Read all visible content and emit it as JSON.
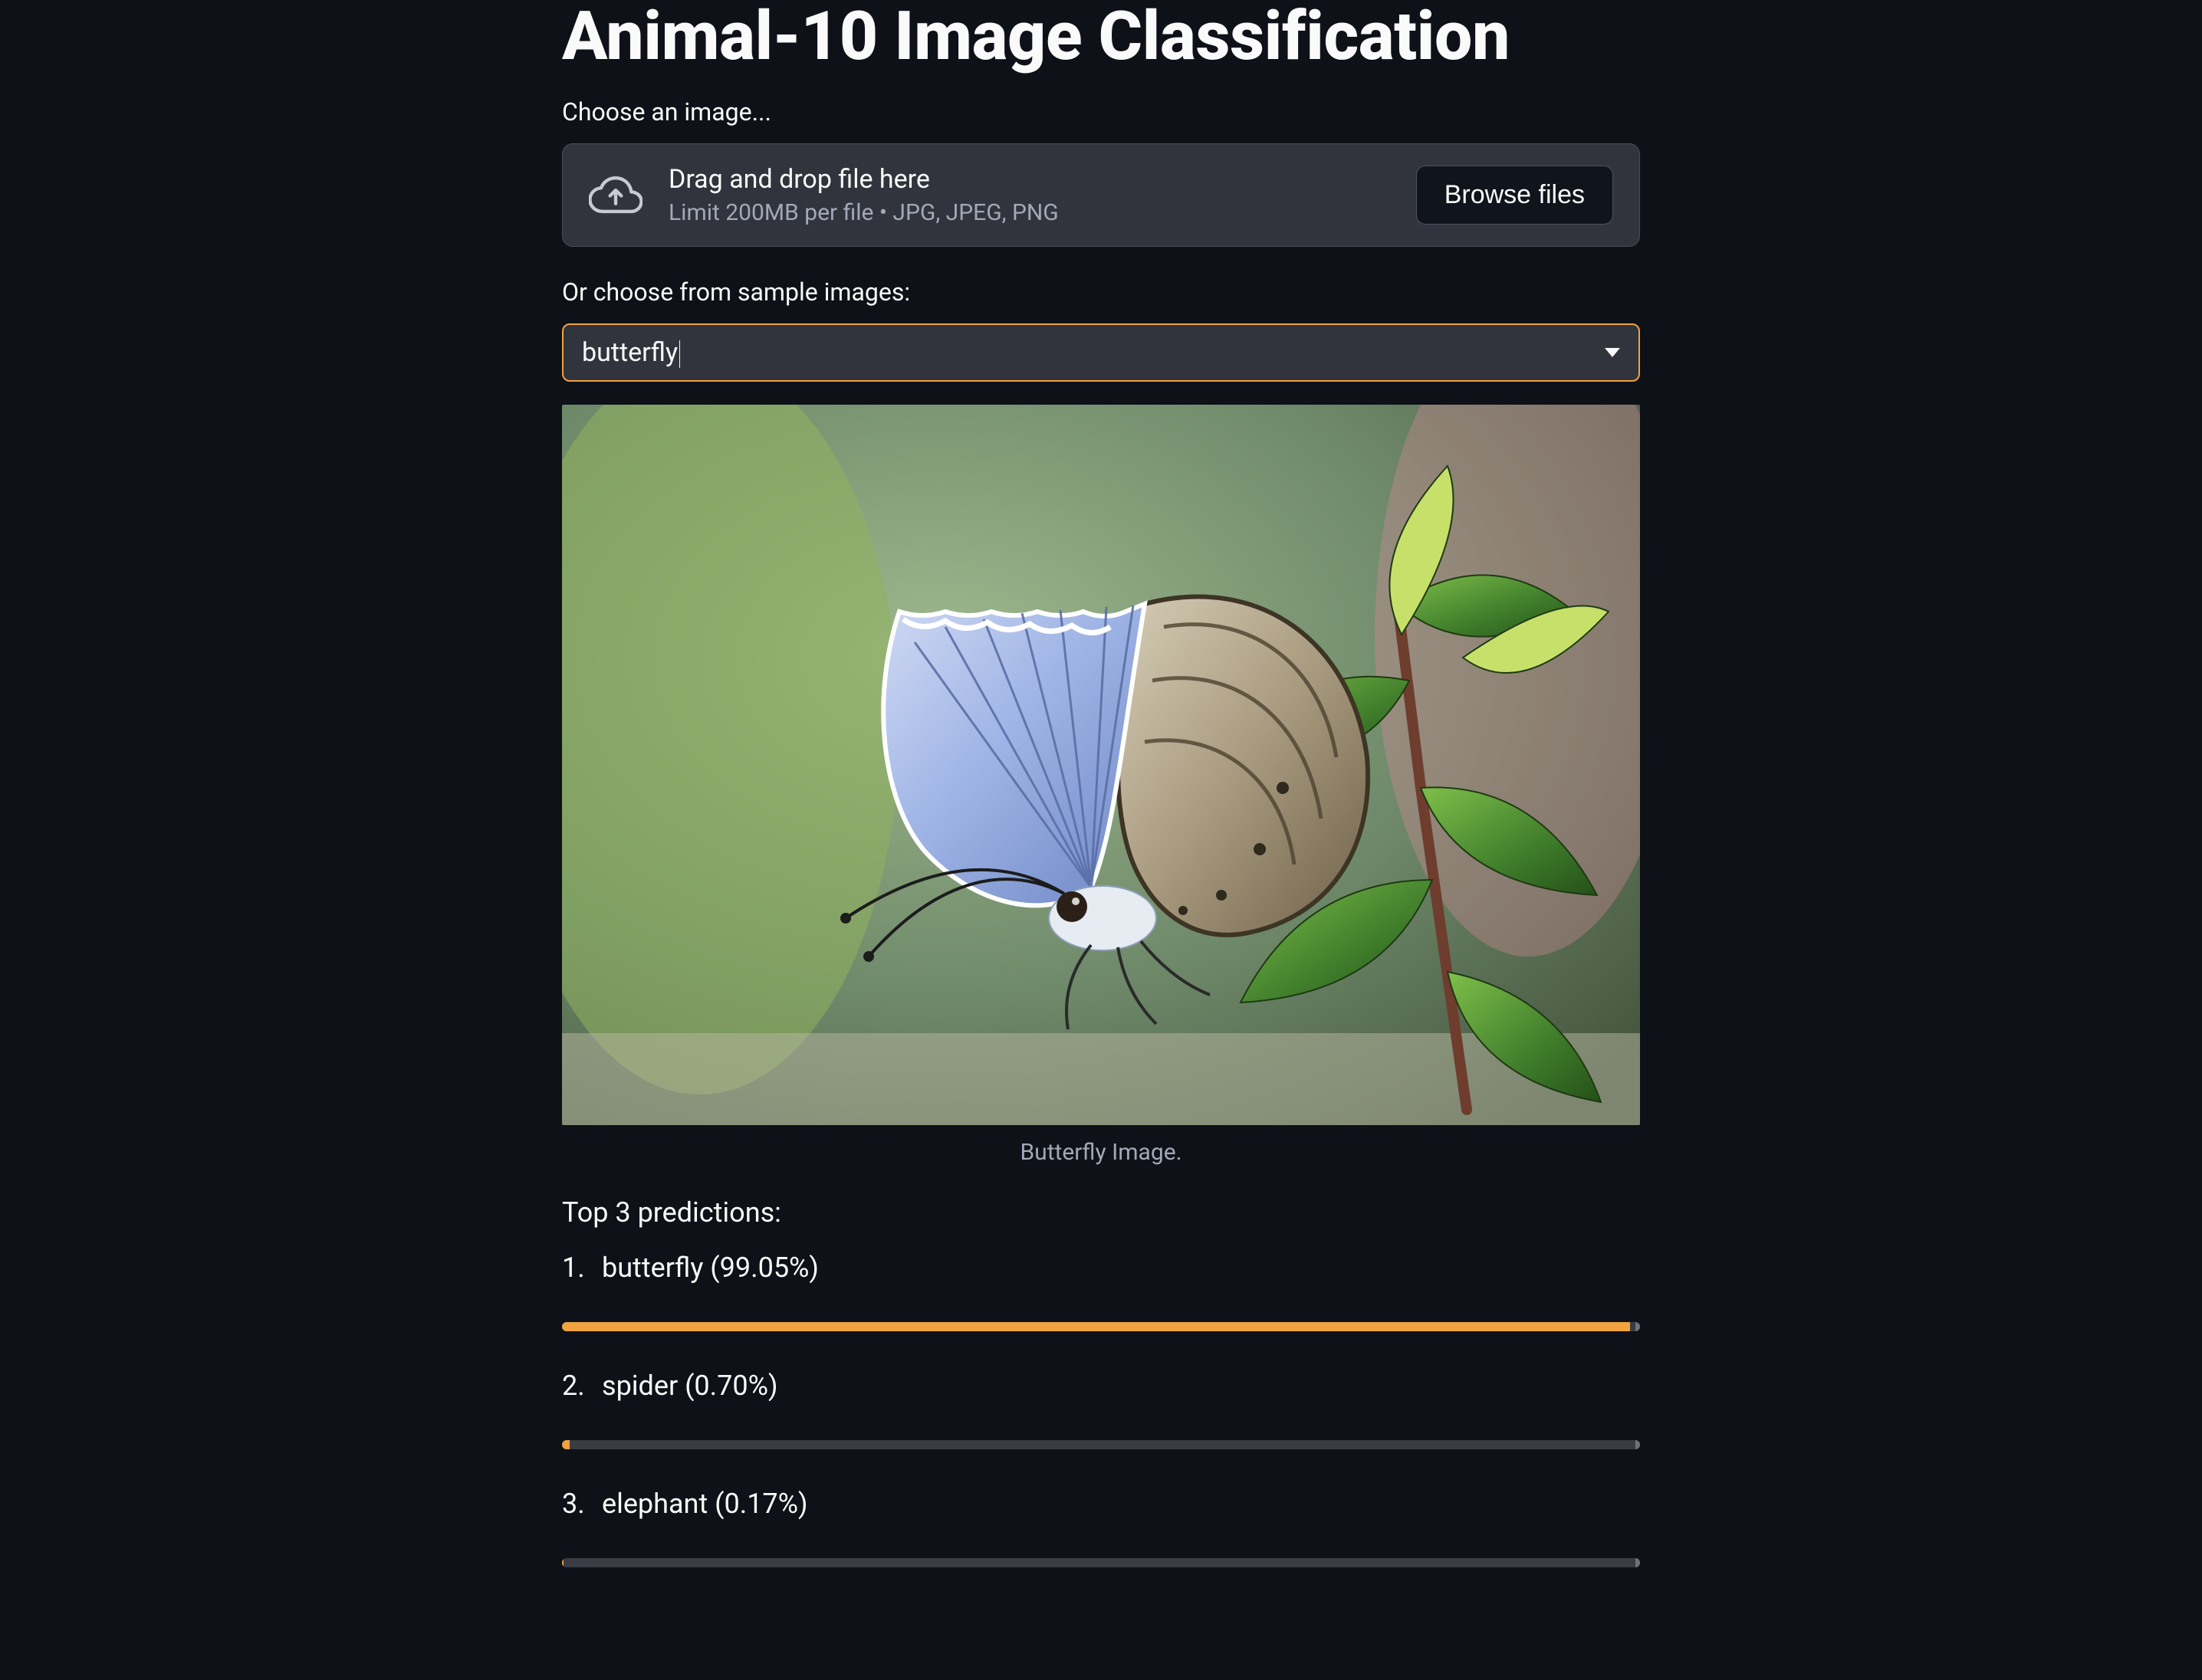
{
  "title": "Animal-10 Image Classification",
  "upload": {
    "label": "Choose an image...",
    "drag_text": "Drag and drop file here",
    "limit_text": "Limit 200MB per file • JPG, JPEG, PNG",
    "browse_label": "Browse files"
  },
  "sample": {
    "label": "Or choose from sample images:",
    "selected": "butterfly"
  },
  "image": {
    "caption": "Butterfly Image."
  },
  "predictions_title": "Top 3 predictions:",
  "predictions": [
    {
      "rank": "1.",
      "text": "butterfly (99.05%)",
      "pct": 99.05
    },
    {
      "rank": "2.",
      "text": "spider (0.70%)",
      "pct": 0.7
    },
    {
      "rank": "3.",
      "text": "elephant (0.17%)",
      "pct": 0.17
    }
  ]
}
